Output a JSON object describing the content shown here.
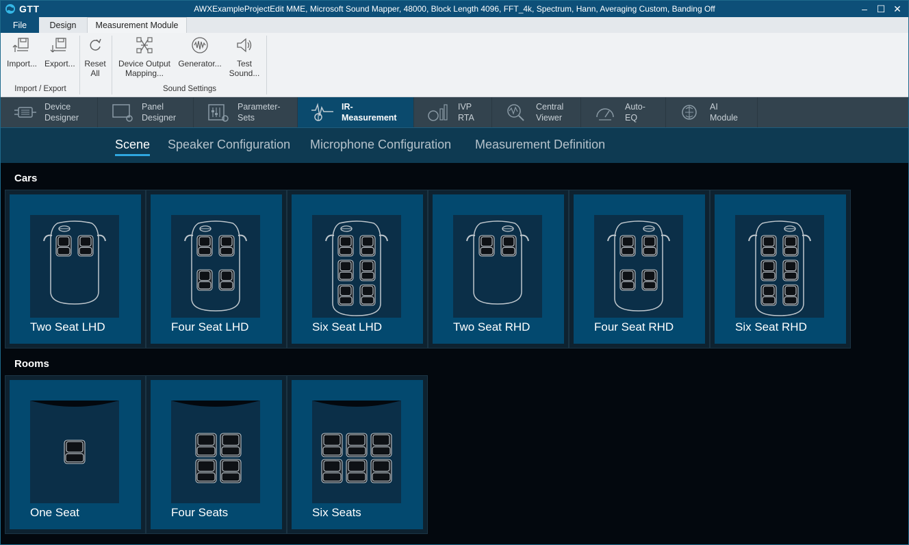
{
  "app": {
    "logo_text": "GTT",
    "window_title": "AWXExampleProjectEdit MME, Microsoft Sound Mapper, 48000, Block Length 4096, FFT_4k, Spectrum, Hann, Averaging Custom, Banding Off",
    "controls": {
      "minimize": "–",
      "maximize": "☐",
      "close": "✕"
    }
  },
  "ribbon_tabs": {
    "file": "File",
    "design": "Design",
    "measurement": "Measurement Module"
  },
  "ribbon": {
    "import": "Import...",
    "export": "Export...",
    "reset_line1": "Reset",
    "reset_line2": "All",
    "device_output_line1": "Device Output",
    "device_output_line2": "Mapping...",
    "generator": "Generator...",
    "test_sound_line1": "Test",
    "test_sound_line2": "Sound...",
    "group_import_export": "Import / Export",
    "group_sound_settings": "Sound Settings"
  },
  "modules": [
    {
      "label": "Device\nDesigner",
      "icon": "device-designer-icon"
    },
    {
      "label": "Panel\nDesigner",
      "icon": "panel-designer-icon"
    },
    {
      "label": "Parameter-\nSets",
      "icon": "parameter-sets-icon"
    },
    {
      "label": "IR-\nMeasurement",
      "icon": "ir-measurement-icon",
      "active": true
    },
    {
      "label": "IVP\nRTA",
      "icon": "ivp-rta-icon"
    },
    {
      "label": "Central\nViewer",
      "icon": "central-viewer-icon"
    },
    {
      "label": "Auto-\nEQ",
      "icon": "auto-eq-icon"
    },
    {
      "label": "AI\nModule",
      "icon": "ai-module-icon"
    }
  ],
  "subtabs": {
    "scene": "Scene",
    "speaker": "Speaker Configuration",
    "microphone": "Microphone Configuration",
    "measurement": "Measurement Definition"
  },
  "sections": {
    "cars": "Cars",
    "rooms": "Rooms"
  },
  "cars": [
    {
      "label": "Two Seat LHD",
      "rows": 1
    },
    {
      "label": "Four Seat LHD",
      "rows": 2
    },
    {
      "label": "Six Seat LHD",
      "rows": 3
    },
    {
      "label": "Two Seat RHD",
      "rows": 1
    },
    {
      "label": "Four Seat RHD",
      "rows": 2
    },
    {
      "label": "Six Seat RHD",
      "rows": 3
    }
  ],
  "rooms": [
    {
      "label": "One Seat"
    },
    {
      "label": "Four Seats"
    },
    {
      "label": "Six Seats"
    }
  ],
  "colors": {
    "accent": "#2fa7e0",
    "card": "#03496f",
    "titlebar": "#0d4f78"
  }
}
